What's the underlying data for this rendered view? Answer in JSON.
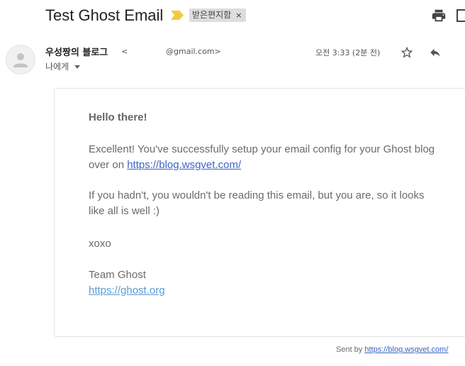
{
  "header": {
    "subject": "Test Ghost Email",
    "label": "받은편지함",
    "label_close": "×",
    "importance_color": "#f4b400"
  },
  "sender": {
    "name": "우성짱의 블로그",
    "bracket_open": "<",
    "email": "@gmail.com>",
    "to_label": "나에게",
    "time": "오전 3:33 (2분 전)"
  },
  "message": {
    "greeting": "Hello there!",
    "p1_text": "Excellent! You've successfully setup your email config for your Ghost blog over on ",
    "p1_link": "https://blog.wsgvet.com/",
    "p2_text": "If you hadn't, you wouldn't be reading this email, but you are, so it looks like all is well :)",
    "p3_text": "xoxo",
    "p4_text": "Team Ghost",
    "p4_link": "https://ghost.org"
  },
  "footer": {
    "sent_by_label": "Sent by",
    "sent_by_link": "https://blog.wsgvet.com/"
  },
  "icons": {
    "print": "print-icon",
    "new_window": "open-in-new-window-icon",
    "star": "star-icon",
    "reply": "reply-icon",
    "avatar": "person-icon"
  }
}
